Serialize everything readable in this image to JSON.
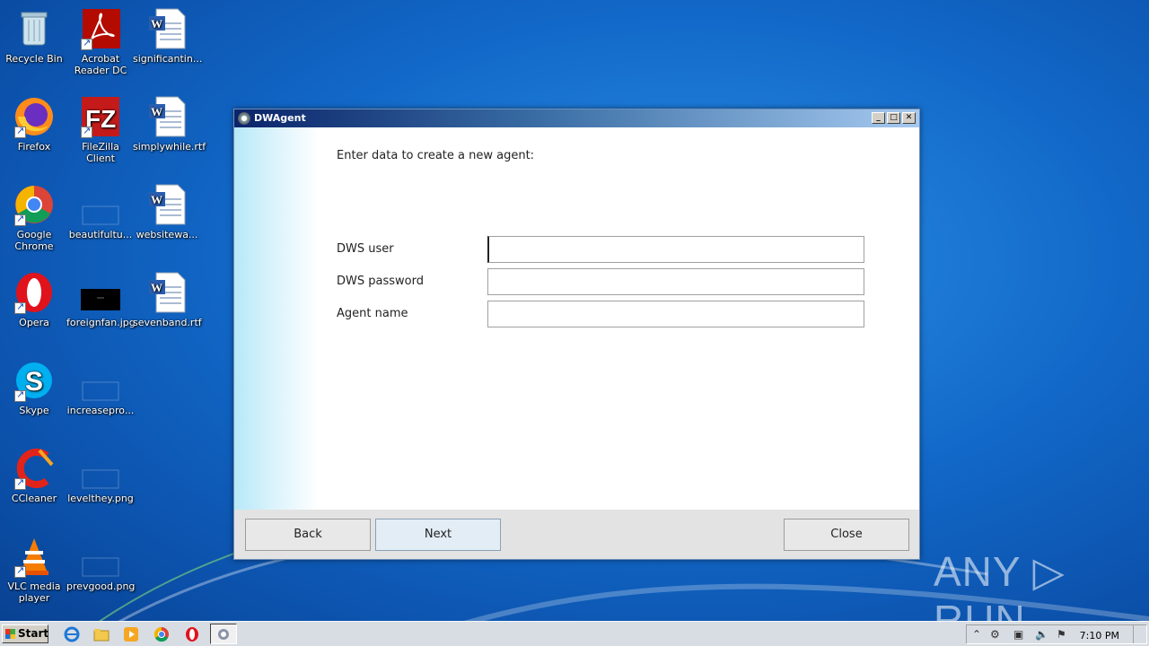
{
  "desktop": {
    "icons": [
      {
        "label": "Recycle Bin"
      },
      {
        "label": "Acrobat Reader DC"
      },
      {
        "label": "significantin..."
      },
      {
        "label": "Firefox"
      },
      {
        "label": "FileZilla Client"
      },
      {
        "label": "simplywhile.rtf"
      },
      {
        "label": "Google Chrome"
      },
      {
        "label": "beautifultu..."
      },
      {
        "label": "websitewa..."
      },
      {
        "label": "Opera"
      },
      {
        "label": "foreignfan.jpg"
      },
      {
        "label": "sevenband.rtf"
      },
      {
        "label": "Skype"
      },
      {
        "label": "increasepro..."
      },
      {
        "label": "CCleaner"
      },
      {
        "label": "levelthey.png"
      },
      {
        "label": "VLC media player"
      },
      {
        "label": "prevgood.png"
      }
    ]
  },
  "window": {
    "title": "DWAgent",
    "heading": "Enter data to create a new agent:",
    "fields": [
      {
        "label": "DWS user",
        "value": ""
      },
      {
        "label": "DWS password",
        "value": ""
      },
      {
        "label": "Agent name",
        "value": ""
      }
    ],
    "buttons": {
      "back": "Back",
      "next": "Next",
      "close": "Close"
    },
    "controls": {
      "minimize": "_",
      "maximize": "□",
      "close": "✕"
    }
  },
  "taskbar": {
    "start_label": "Start",
    "clock": "7:10 PM"
  },
  "watermark": {
    "text": "ANY ▷ RUN"
  }
}
